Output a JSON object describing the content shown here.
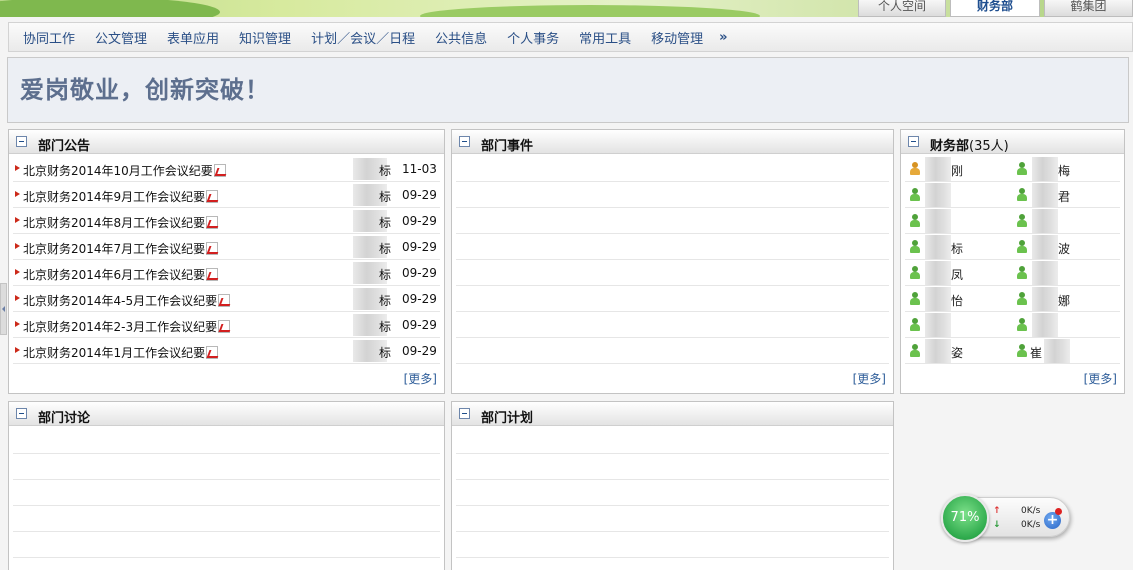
{
  "header": {
    "tabs": [
      {
        "label": "个人空间",
        "active": false
      },
      {
        "label": "财务部",
        "active": true
      },
      {
        "label": "鹤集团",
        "active": false
      }
    ]
  },
  "nav": {
    "items": [
      "协同工作",
      "公文管理",
      "表单应用",
      "知识管理",
      "计划／会议／日程",
      "公共信息",
      "个人事务",
      "常用工具",
      "移动管理"
    ],
    "more": "»"
  },
  "slogan": "爱岗敬业，创新突破！",
  "panels": {
    "notices": {
      "title": "部门公告",
      "more": "[更多]",
      "items": [
        {
          "title": "北京财务2014年10月工作会议纪要",
          "author": "标",
          "date": "11-03"
        },
        {
          "title": "北京财务2014年9月工作会议纪要",
          "author": "标",
          "date": "09-29"
        },
        {
          "title": "北京财务2014年8月工作会议纪要",
          "author": "标",
          "date": "09-29"
        },
        {
          "title": "北京财务2014年7月工作会议纪要",
          "author": "标",
          "date": "09-29"
        },
        {
          "title": "北京财务2014年6月工作会议纪要",
          "author": "标",
          "date": "09-29"
        },
        {
          "title": "北京财务2014年4-5月工作会议纪要",
          "author": "标",
          "date": "09-29"
        },
        {
          "title": "北京财务2014年2-3月工作会议纪要",
          "author": "标",
          "date": "09-29"
        },
        {
          "title": "北京财务2014年1月工作会议纪要",
          "author": "标",
          "date": "09-29"
        }
      ]
    },
    "events": {
      "title": "部门事件",
      "more": "[更多]"
    },
    "members": {
      "title": "财务部",
      "count": "(35人)",
      "more": "[更多]",
      "people": [
        {
          "name": "刚",
          "leader": true
        },
        {
          "name": "梅",
          "leader": false
        },
        {
          "name": "",
          "leader": false
        },
        {
          "name": "君",
          "leader": false
        },
        {
          "name": "",
          "leader": false
        },
        {
          "name": "",
          "leader": false
        },
        {
          "name": "标",
          "leader": false
        },
        {
          "name": "波",
          "leader": false
        },
        {
          "name": "凤",
          "leader": false
        },
        {
          "name": "",
          "leader": false
        },
        {
          "name": "怡",
          "leader": false
        },
        {
          "name": "娜",
          "leader": false
        },
        {
          "name": "",
          "leader": false
        },
        {
          "name": "",
          "leader": false
        },
        {
          "name": "姿",
          "leader": false
        },
        {
          "name": "崔",
          "leader": false
        }
      ]
    },
    "discussion": {
      "title": "部门讨论"
    },
    "plans": {
      "title": "部门计划"
    }
  },
  "speed_widget": {
    "percent": "71%",
    "up_rate": "0K/s",
    "down_rate": "0K/s",
    "colors": {
      "gauge": "#2fab4d",
      "up": "#dd3333",
      "down": "#2b9a3a"
    }
  },
  "icons": {
    "collapse": "minus-box-icon",
    "bullet": "red-arrow-icon",
    "attachment": "pdf-icon",
    "member": "person-icon",
    "upload": "arrow-up-icon",
    "download": "arrow-down-icon",
    "add": "plus-icon"
  }
}
